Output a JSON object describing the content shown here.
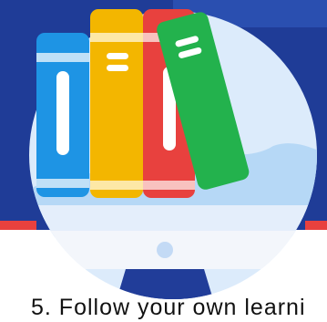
{
  "caption": "5. Follow your own learni",
  "illustration": {
    "icon": "books-on-monitor-icon",
    "colors": {
      "background_navy": "#1f3c97",
      "screen_light": "#dcebfb",
      "screen_sky": "#b6d8f6",
      "monitor_stand": "#213d99",
      "book_blue": "#1e94e4",
      "book_yellow": "#f3b600",
      "book_red": "#e8413e",
      "book_green": "#23b24d",
      "band_white": "#f3f6fb",
      "accent_red": "#e8413e"
    }
  }
}
